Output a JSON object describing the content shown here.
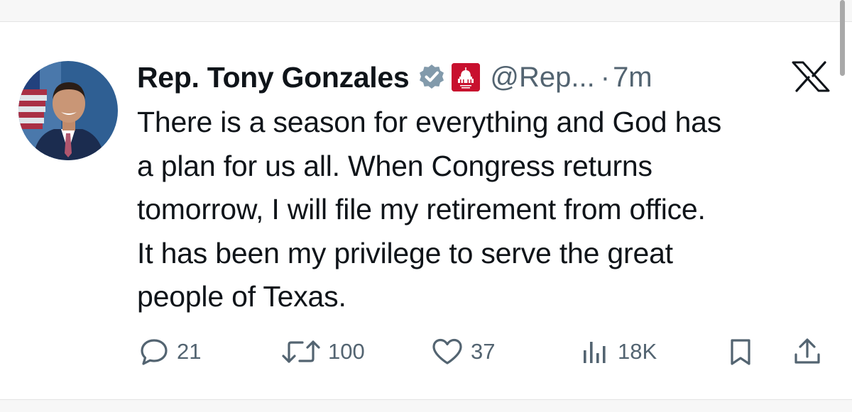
{
  "tweet": {
    "display_name": "Rep. Tony Gonzales",
    "handle": "@Rep...",
    "separator": "·",
    "time": "7m",
    "text_lines": [
      "There is a season for everything and God has",
      "a plan for us all. When Congress returns",
      "tomorrow, I will file my retirement from office.",
      "It has been my privilege to serve the great",
      "people of Texas."
    ]
  },
  "badges": {
    "verified": "verified-badge",
    "affiliation": "house-gop-badge"
  },
  "actions": {
    "reply_count": "21",
    "retweet_count": "100",
    "like_count": "37",
    "views_count": "18K"
  },
  "icons": {
    "platform": "x-logo",
    "reply": "reply-icon",
    "retweet": "retweet-icon",
    "like": "heart-icon",
    "views": "views-icon",
    "bookmark": "bookmark-icon",
    "share": "share-icon"
  },
  "colors": {
    "text": "#0f1419",
    "secondary": "#536471",
    "affiliation_red": "#c8102e",
    "verified_gray": "#829aab"
  }
}
